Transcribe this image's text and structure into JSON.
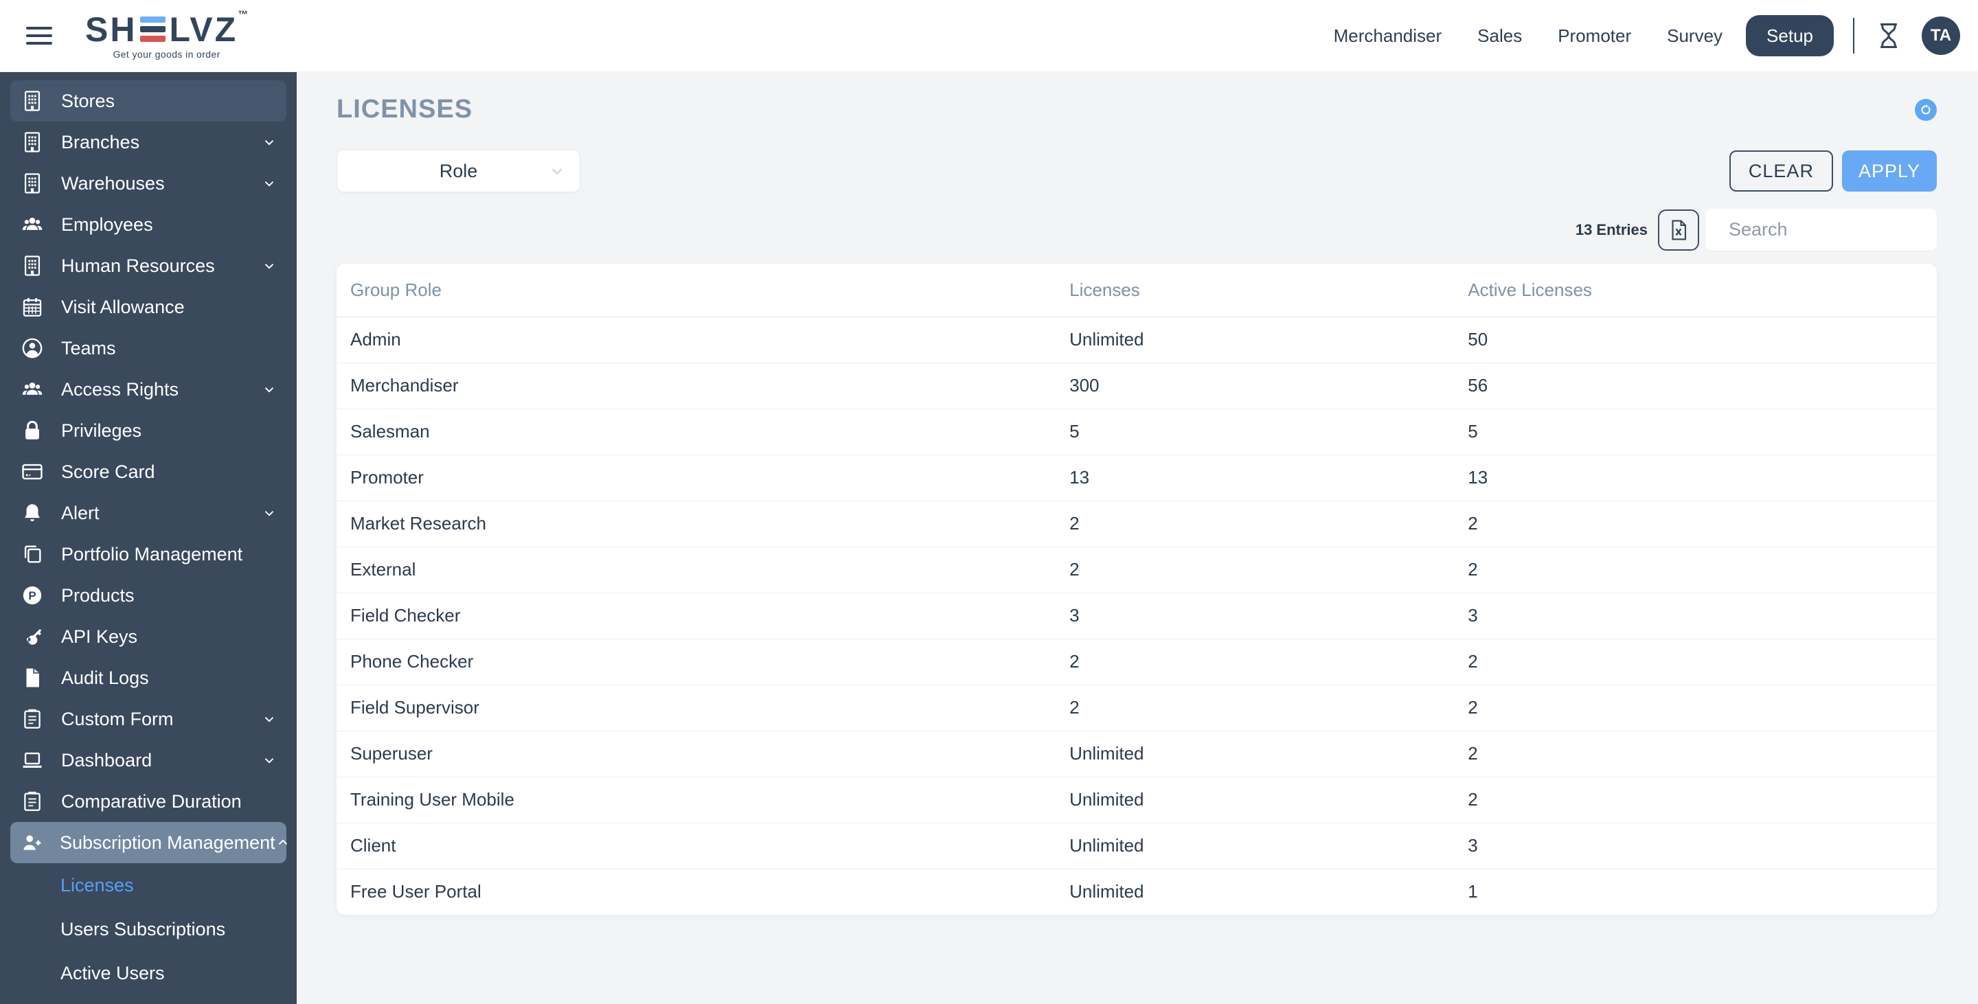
{
  "header": {
    "logo": {
      "part1": "SH",
      "part2": "LVZ",
      "tm": "™",
      "tagline": "Get your goods in order"
    },
    "nav": [
      {
        "label": "Merchandiser"
      },
      {
        "label": "Sales"
      },
      {
        "label": "Promoter"
      },
      {
        "label": "Survey"
      }
    ],
    "setup_label": "Setup",
    "avatar_initials": "TA"
  },
  "sidebar": {
    "items": [
      {
        "label": "Stores",
        "icon": "building-icon",
        "active": true
      },
      {
        "label": "Branches",
        "icon": "building-icon",
        "chevron": true
      },
      {
        "label": "Warehouses",
        "icon": "building-icon",
        "chevron": true
      },
      {
        "label": "Employees",
        "icon": "people-group-icon"
      },
      {
        "label": "Human Resources",
        "icon": "building-icon",
        "chevron": true
      },
      {
        "label": "Visit Allowance",
        "icon": "calendar-icon"
      },
      {
        "label": "Teams",
        "icon": "person-circle-icon"
      },
      {
        "label": "Access Rights",
        "icon": "people-group-icon",
        "chevron": true
      },
      {
        "label": "Privileges",
        "icon": "lock-icon"
      },
      {
        "label": "Score Card",
        "icon": "credit-card-icon"
      },
      {
        "label": "Alert",
        "icon": "bell-icon",
        "chevron": true
      },
      {
        "label": "Portfolio Management",
        "icon": "copy-icon"
      },
      {
        "label": "Products",
        "icon": "p-circle-icon"
      },
      {
        "label": "API Keys",
        "icon": "key-icon"
      },
      {
        "label": "Audit Logs",
        "icon": "file-icon"
      },
      {
        "label": "Custom Form",
        "icon": "clipboard-icon",
        "chevron": true
      },
      {
        "label": "Dashboard",
        "icon": "laptop-icon",
        "chevron": true
      },
      {
        "label": "Comparative Duration",
        "icon": "clipboard-icon"
      },
      {
        "label": "Subscription Management",
        "icon": "person-plus-icon",
        "chevron_up": true,
        "active": true
      }
    ],
    "sub_items": [
      {
        "label": "Licenses",
        "active": true
      },
      {
        "label": "Users Subscriptions"
      },
      {
        "label": "Active Users"
      }
    ]
  },
  "main": {
    "title": "LICENSES",
    "filter": {
      "role_label": "Role"
    },
    "buttons": {
      "clear": "CLEAR",
      "apply": "APPLY"
    },
    "entries_label": "13 Entries",
    "search_placeholder": "Search",
    "table": {
      "columns": [
        "Group Role",
        "Licenses",
        "Active Licenses"
      ],
      "rows": [
        {
          "role": "Admin",
          "licenses": "Unlimited",
          "active": "50"
        },
        {
          "role": "Merchandiser",
          "licenses": "300",
          "active": "56"
        },
        {
          "role": "Salesman",
          "licenses": "5",
          "active": "5"
        },
        {
          "role": "Promoter",
          "licenses": "13",
          "active": "13"
        },
        {
          "role": "Market Research",
          "licenses": "2",
          "active": "2"
        },
        {
          "role": "External",
          "licenses": "2",
          "active": "2"
        },
        {
          "role": "Field Checker",
          "licenses": "3",
          "active": "3"
        },
        {
          "role": "Phone Checker",
          "licenses": "2",
          "active": "2"
        },
        {
          "role": "Field Supervisor",
          "licenses": "2",
          "active": "2"
        },
        {
          "role": "Superuser",
          "licenses": "Unlimited",
          "active": "2"
        },
        {
          "role": "Training User Mobile",
          "licenses": "Unlimited",
          "active": "2"
        },
        {
          "role": "Client",
          "licenses": "Unlimited",
          "active": "3"
        },
        {
          "role": "Free User Portal",
          "licenses": "Unlimited",
          "active": "1"
        }
      ]
    }
  },
  "colors": {
    "sidebar_bg": "#3a495c",
    "sidebar_item_active": "#46566c",
    "sidebar_item_active_strong": "#72879e",
    "dark_navy": "#33455c",
    "accent_blue": "#68a9f5",
    "link_blue": "#55a1f7",
    "logo_blue": "#6db0f7",
    "logo_red": "#d9534f",
    "muted_heading": "#7f92a8",
    "content_bg": "#f2f4f6"
  }
}
